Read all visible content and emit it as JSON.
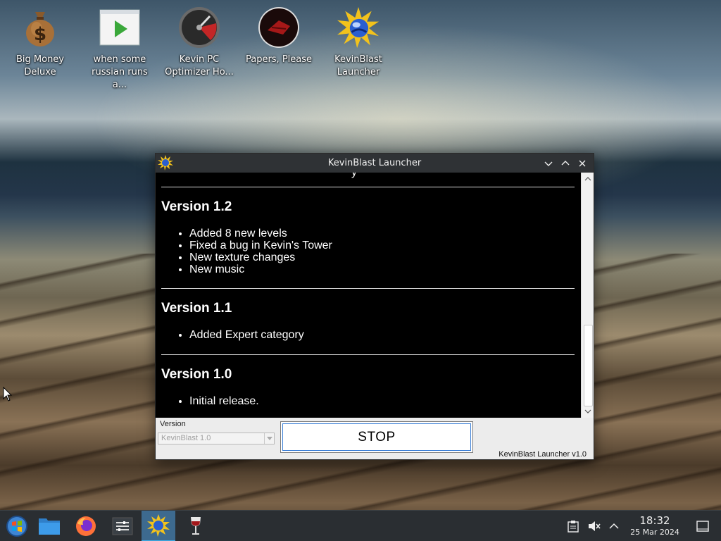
{
  "desktop": {
    "icons": [
      {
        "label": "Big Money\nDeluxe",
        "icon": "money-bag-icon"
      },
      {
        "label": "when some\nrussian runs a...",
        "icon": "video-play-icon"
      },
      {
        "label": "Kevin PC\nOptimizer Ho...",
        "icon": "speedometer-icon"
      },
      {
        "label": "Papers, Please",
        "icon": "papers-please-seal-icon"
      },
      {
        "label": "KevinBlast\nLauncher",
        "icon": "kevinblast-burst-icon"
      }
    ]
  },
  "window": {
    "title": "KevinBlast Launcher",
    "cut_off_text": "y",
    "releases": [
      {
        "heading": "Version 1.2",
        "items": [
          "Added 8 new levels",
          "Fixed a bug in Kevin's Tower",
          "New texture changes",
          "New music"
        ]
      },
      {
        "heading": "Version 1.1",
        "items": [
          "Added Expert category"
        ]
      },
      {
        "heading": "Version 1.0",
        "items": [
          "Initial release."
        ]
      }
    ],
    "version_label": "Version",
    "version_selected": "KevinBlast 1.0",
    "stop_label": "STOP",
    "footer": "KevinBlast Launcher v1.0"
  },
  "taskbar": {
    "items": [
      "start-menu-icon",
      "file-manager-icon",
      "firefox-icon",
      "settings-icon",
      "kevinblast-launcher-icon",
      "wine-glass-icon"
    ],
    "active_item": "kevinblast-launcher-icon",
    "tray": [
      "clipboard-icon",
      "volume-muted-icon",
      "tray-expand-icon"
    ],
    "time": "18:32",
    "date": "25 Mar 2024"
  },
  "colors": {
    "taskbar_bg": "#2a2e32",
    "active_task": "#3d6a8f",
    "accent": "#3daee9",
    "titlebar": "#2f3235",
    "notes_bg": "#000000"
  }
}
